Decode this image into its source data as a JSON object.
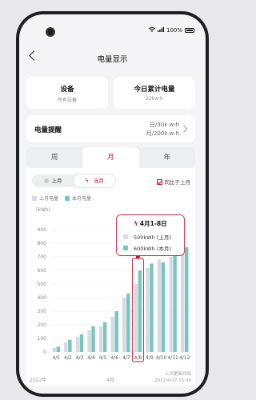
{
  "status": {
    "battery": "100%"
  },
  "header": {
    "title": "电量显示"
  },
  "cards": {
    "device": {
      "title": "设备",
      "sub": "所有设备"
    },
    "today": {
      "title": "今日累计电量",
      "sub": "22kw·h"
    },
    "reminder": {
      "label": "电量提醒",
      "daily": "日/30k w·h",
      "monthly": "月/200k w·h"
    }
  },
  "tabs": [
    {
      "label": "周"
    },
    {
      "label": "月"
    },
    {
      "label": "年"
    }
  ],
  "active_tab": "月",
  "segment": {
    "items": [
      "上月",
      "当月"
    ],
    "active": "当月"
  },
  "compare_label": "同比于上月",
  "legend": {
    "prev": "上月电量",
    "curr": "本月电量"
  },
  "colors": {
    "accent": "#c8102e",
    "prev": "#d7d9e3",
    "curr": "#74c7bd"
  },
  "tooltip": {
    "title": "4月1-8日",
    "prev": "500kWh (上月)",
    "curr": "600kWh (本月)"
  },
  "footer": {
    "left": "2022年",
    "center": "4月",
    "right_top": "上次更新时间",
    "right_bottom": "2022/4/17 15:00"
  },
  "chart_data": {
    "type": "bar",
    "ylabel": "(kWh)",
    "ylim": [
      0,
      1000
    ],
    "yticks": [
      0,
      100,
      200,
      300,
      400,
      500,
      600,
      700,
      800,
      900
    ],
    "categories": [
      "4/1",
      "4/2",
      "4/3",
      "4/4",
      "4/5",
      "4/6",
      "4/7",
      "4/8",
      "4/9",
      "4/10",
      "4/11",
      "4/12"
    ],
    "highlight": "4/8",
    "series": [
      {
        "name": "上月电量",
        "values": [
          30,
          70,
          110,
          160,
          190,
          260,
          400,
          500,
          620,
          680,
          700,
          740
        ]
      },
      {
        "name": "本月电量",
        "values": [
          40,
          90,
          130,
          190,
          220,
          300,
          430,
          600,
          650,
          660,
          720,
          770
        ]
      }
    ]
  }
}
